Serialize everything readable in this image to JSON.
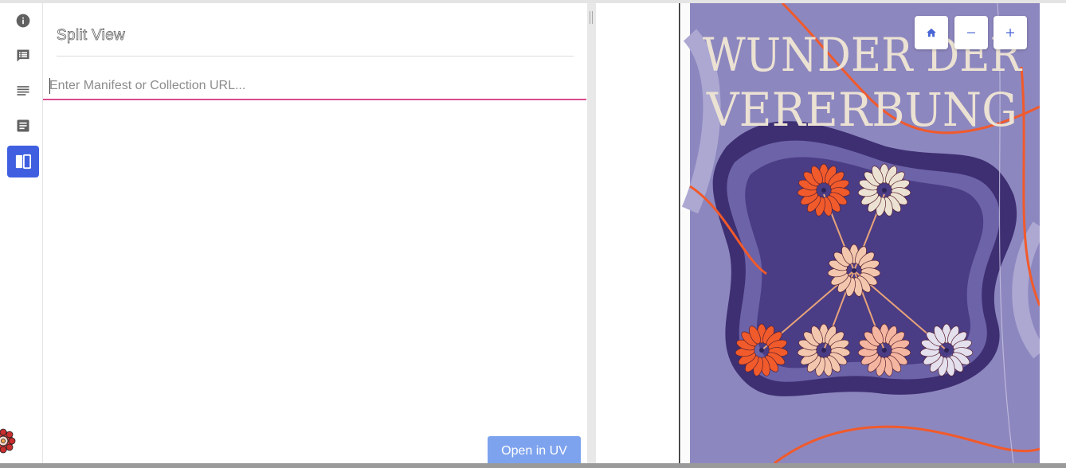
{
  "sidebar": {
    "items": [
      {
        "icon": "info-icon"
      },
      {
        "icon": "feedback-icon"
      },
      {
        "icon": "subject-icon"
      },
      {
        "icon": "article-icon"
      },
      {
        "icon": "split-view-icon",
        "active": true
      }
    ]
  },
  "panel": {
    "title": "Split View",
    "url_placeholder": "Enter Manifest or Collection URL...",
    "url_value": "",
    "open_button": "Open in UV"
  },
  "viewer": {
    "cover_title_line1": "WUNDER DER",
    "cover_title_line2": "VERERBUNG",
    "controls": [
      {
        "name": "home",
        "icon": "home-icon"
      },
      {
        "name": "zoom-out",
        "icon": "minus-icon"
      },
      {
        "name": "zoom-in",
        "icon": "plus-icon"
      }
    ]
  },
  "colors": {
    "accent": "#3f5fe0",
    "input_underline": "#d94b8c",
    "button": "#7ea3ee",
    "cover_background": "#3e2f72",
    "cover_title": "#ece2d3",
    "cover_orange": "#f15a2b"
  }
}
